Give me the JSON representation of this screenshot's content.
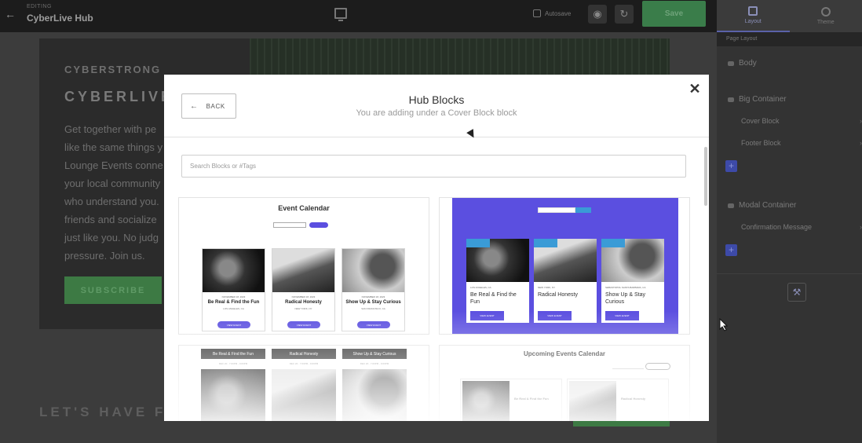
{
  "topbar": {
    "editing_label": "EDITING",
    "title": "CyberLive Hub",
    "autosave_label": "Autosave",
    "save_label": "Save"
  },
  "right_panel": {
    "tabs": [
      {
        "label": "Layout",
        "active": true
      },
      {
        "label": "Theme",
        "active": false
      }
    ],
    "section_header": "Page Layout",
    "layers": {
      "body": "Body",
      "big_container": "Big Container",
      "cover_block": "Cover Block",
      "footer_block": "Footer Block",
      "modal_container": "Modal Container",
      "confirmation_message": "Confirmation Message"
    },
    "add_symbol": "+"
  },
  "canvas": {
    "brand": "CYBERSTRONG",
    "hero_title": "CYBERLIVE",
    "hero_text": "Get together with pe like the same things y Lounge Events conne your local community who understand you. friends and socialize just like you. No judg pressure. Join us.",
    "subscribe_label": "SUBSCRIBE",
    "section_heading": "LET'S HAVE FU"
  },
  "modal": {
    "back_label": "BACK",
    "title": "Hub Blocks",
    "subtitle": "You are adding under a Cover Block block",
    "search_placeholder": "Search Blocks or #Tags",
    "cards": {
      "event_calendar": {
        "title": "Event Calendar",
        "events": [
          {
            "date": "NOVEMBER 18, 2023",
            "title": "Be Real & Find the Fun",
            "location": "LOS ANGELES, CA",
            "btn": "VIEW EVENT"
          },
          {
            "date": "NOVEMBER 18, 2023",
            "title": "Radical Honesty",
            "location": "NEW YORK, NY",
            "btn": "VIEW EVENT"
          },
          {
            "date": "NOVEMBER 18, 2023",
            "title": "Show Up & Stay Curious",
            "location": "SAN FRANCISCO, CA",
            "btn": "VIEW EVENT"
          }
        ]
      },
      "purple_events": {
        "events": [
          {
            "date": "LOS ANGELES, CA",
            "title": "Be Real & Find the Fun",
            "btn": "VIEW EVENT"
          },
          {
            "date": "NEW YORK, NY",
            "title": "Radical Honesty",
            "btn": "VIEW EVENT"
          },
          {
            "date": "SEBASTOPOL SANTA BARBARA, CA",
            "title": "Show Up & Stay Curious",
            "btn": "VIEW EVENT"
          }
        ]
      },
      "dark_headers": {
        "events": [
          {
            "title": "Be Real & Find the Fun",
            "sub": "DEC 20 · 7:00PM - 9:00PM"
          },
          {
            "title": "Radical Honesty",
            "sub": "DEC 20 · 7:00PM - 9:00PM"
          },
          {
            "title": "Show Up & Stay Curious",
            "sub": "DEC 20 · 7:00PM - 9:00PM"
          }
        ]
      },
      "upcoming_calendar": {
        "title": "Upcoming Events Calendar",
        "events": [
          {
            "title": "Be Real & Find the Fun"
          },
          {
            "title": "Radical Honesty"
          }
        ]
      }
    }
  },
  "colors": {
    "accent_purple": "#5b4fe0",
    "save_green": "#3a7d4a",
    "tag_blue": "#3a9bd6"
  }
}
